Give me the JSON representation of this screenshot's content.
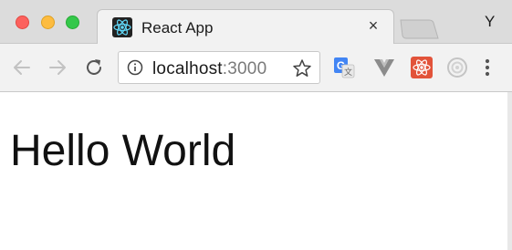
{
  "window": {
    "profile_initial": "Y"
  },
  "tab": {
    "title": "React App",
    "close_glyph": "×",
    "favicon_icon": "react-icon"
  },
  "toolbar": {
    "address": {
      "host": "localhost",
      "port": ":3000"
    },
    "extensions": [
      "google-translate-icon",
      "vue-devtools-icon",
      "react-devtools-icon",
      "camera-icon"
    ]
  },
  "page": {
    "heading": "Hello World"
  },
  "colors": {
    "close": "#fc615d",
    "minimize": "#fdbc40",
    "maximize": "#34c84a",
    "react": "#61dafb",
    "translate": "#4285f4",
    "vue": "#8c8c8c"
  }
}
